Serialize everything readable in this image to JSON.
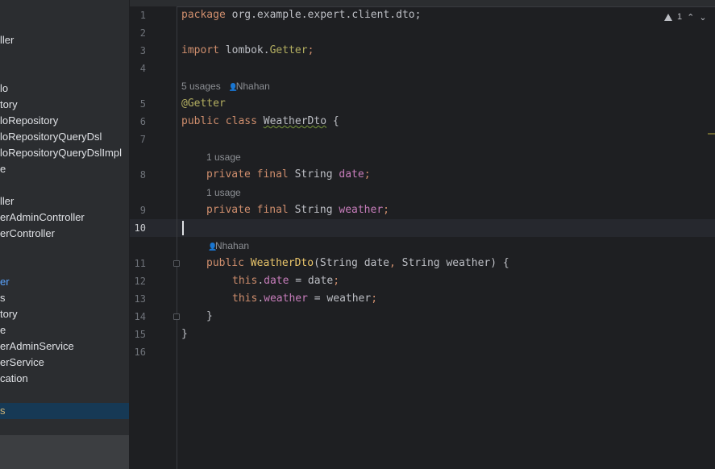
{
  "sidebar": {
    "items": [
      {
        "label": "ller"
      },
      {
        "label": "lo"
      },
      {
        "label": "tory"
      },
      {
        "label": "loRepository"
      },
      {
        "label": "loRepositoryQueryDsl"
      },
      {
        "label": "loRepositoryQueryDslImpl"
      },
      {
        "label": "e"
      },
      {
        "label": "ller"
      },
      {
        "label": "erAdminController"
      },
      {
        "label": "erController"
      },
      {
        "label": "er"
      },
      {
        "label": "s"
      },
      {
        "label": "tory"
      },
      {
        "label": "e"
      },
      {
        "label": "erAdminService"
      },
      {
        "label": "erService"
      },
      {
        "label": "cation"
      },
      {
        "label": "s"
      }
    ]
  },
  "editor": {
    "line_numbers": [
      "1",
      "2",
      "3",
      "4",
      "5",
      "6",
      "7",
      "8",
      "9",
      "10",
      "11",
      "12",
      "13",
      "14",
      "15",
      "16"
    ],
    "hints": {
      "usages_5": "5 usages",
      "author": "Nhahan",
      "usage_1a": "1 usage",
      "usage_1b": "1 usage",
      "author2": "Nhahan"
    },
    "code": {
      "l1_kw": "package",
      "l1_rest": " org.example.expert.client.dto;",
      "l3_kw": "import",
      "l3_pkg": " lombok.",
      "l3_cls": "Getter",
      "l3_semi": ";",
      "l5_ann": "@Getter",
      "l6_kw": "public class",
      "l6_sp": " ",
      "l6_cls": "WeatherDto",
      "l6_rest": " {",
      "l8_kw": "private final",
      "l8_type": " String ",
      "l8_fld": "date",
      "l8_semi": ";",
      "l9_kw": "private final",
      "l9_type": " String ",
      "l9_fld": "weather",
      "l9_semi": ";",
      "l11_kw": "public",
      "l11_sp": " ",
      "l11_fn": "WeatherDto",
      "l11_p1": "(String date",
      "l11_comma": ",",
      "l11_p2": " String weather) {",
      "l12_this": "this",
      "l12_dot": ".",
      "l12_fld": "date",
      "l12_rest": " = date",
      "l12_semi": ";",
      "l13_this": "this",
      "l13_dot": ".",
      "l13_fld": "weather",
      "l13_rest": " = weather",
      "l13_semi": ";",
      "l14": "}",
      "l15": "}"
    }
  },
  "inspection": {
    "warning_count": "1",
    "icon": "warning-icon"
  }
}
